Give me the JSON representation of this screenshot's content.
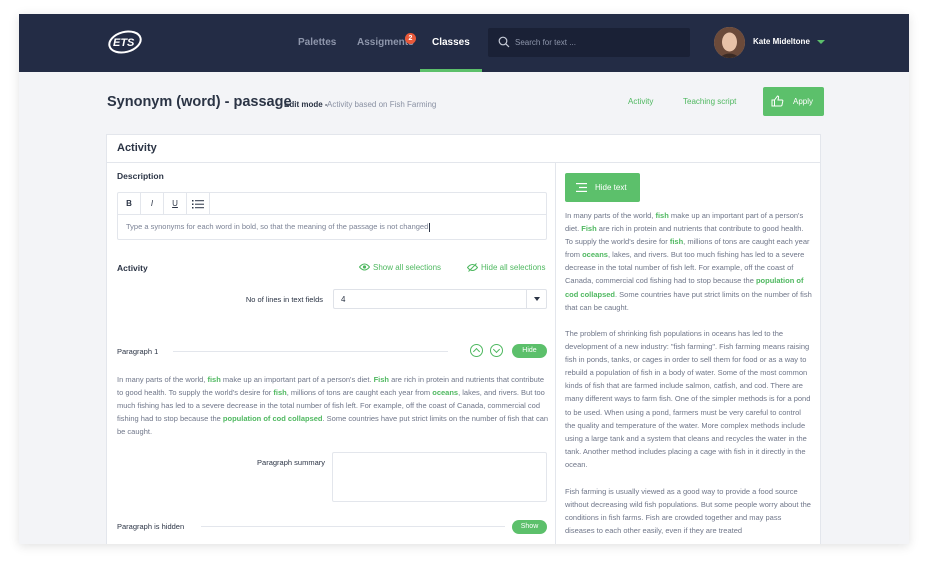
{
  "colors": {
    "navy": "#232c45",
    "accent": "#5cc06b",
    "badge": "#e8593a"
  },
  "nav": {
    "logo": "ETS",
    "items": [
      "Palettes",
      "Assigments",
      "Classes"
    ],
    "badge_count": "2",
    "active": "Classes"
  },
  "search": {
    "placeholder": "Search for text ..."
  },
  "user": {
    "name": "Kate Mideltone"
  },
  "header": {
    "title": "Synonym (word) - passage",
    "mode": "Edit mode -",
    "subtitle": "Activity based on Fish Farming",
    "links": [
      "Activity",
      "Teaching script"
    ],
    "apply": "Apply"
  },
  "card": {
    "title": "Activity",
    "description_label": "Description",
    "toolbar": [
      "B",
      "I",
      "U",
      "list-icon"
    ],
    "description_text": "Type a synonyms for each word in bold, so that the meaning of the passage is not changed",
    "activity_label": "Activity",
    "show_all": "Show all selections",
    "hide_all": "Hide all selections",
    "lines_label": "No of lines in text fields",
    "lines_value": "4",
    "paragraph1_label": "Paragraph 1",
    "hide_btn": "Hide",
    "paragraph_summary_label": "Paragraph summary",
    "paragraph_hidden_label": "Paragraph is hidden",
    "show_btn": "Show",
    "hide_text_btn": "Hide text"
  },
  "passage_left": [
    {
      "t": "In many parts of the world, "
    },
    {
      "t": "fish",
      "b": true
    },
    {
      "t": " make up an important part of a person's diet. "
    },
    {
      "t": "Fish",
      "b": true
    },
    {
      "t": " are rich in protein and nutrients that contribute to good health.  To supply the world's desire for "
    },
    {
      "t": "fish",
      "b": true
    },
    {
      "t": ", millions of tons are caught each year from "
    },
    {
      "t": "oceans",
      "b": true
    },
    {
      "t": ", lakes, and rivers.  But too much fishing has led to a severe decrease in the total number of fish left.  For example, off the coast of Canada, commercial cod fishing had to stop because the "
    },
    {
      "t": "population of cod collapsed",
      "b": true
    },
    {
      "t": ". Some countries have put strict limits on the number of fish that can be caught."
    }
  ],
  "passage_right_1": [
    {
      "t": "In many parts of the world, "
    },
    {
      "t": "fish",
      "b": true
    },
    {
      "t": " make up an important part of a person's diet. "
    },
    {
      "t": "Fish",
      "b": true
    },
    {
      "t": " are rich in protein and nutrients that contribute to good health.  To supply the world's desire for "
    },
    {
      "t": "fish",
      "b": true
    },
    {
      "t": ", millions of tons are caught each year from "
    },
    {
      "t": "oceans",
      "b": true
    },
    {
      "t": ", lakes, and rivers.  But too much fishing has led to a severe decrease in the total number of fish left. For example, off the coast of Canada, commercial cod fishing had to stop because the "
    },
    {
      "t": "population of cod collapsed",
      "b": true
    },
    {
      "t": ". Some countries have put strict limits on the number of fish that can be caught."
    }
  ],
  "passage_right_2": "The problem of shrinking fish populations in oceans has led to the development of a new industry: \"fish farming\".  Fish farming means raising fish in ponds, tanks, or cages in order to sell them for food or as a way to rebuild a population of fish in a body of water.  Some of the most common kinds of fish that are farmed include salmon, catfish, and cod.  There are many different ways to farm fish.  One of the simpler methods is for a pond to be used.  When using a pond, farmers must be very careful to control the quality and temperature of the water.  More complex methods include using a large tank and a system that cleans and recycles the water in the tank.  Another method includes placing a cage with fish in it directly in the ocean.",
  "passage_right_3": "Fish farming is usually viewed as a good way to provide a food source without decreasing wild fish populations.  But some people worry about the conditions in fish farms.  Fish are crowded together and may pass diseases to each other easily, even if they are treated"
}
